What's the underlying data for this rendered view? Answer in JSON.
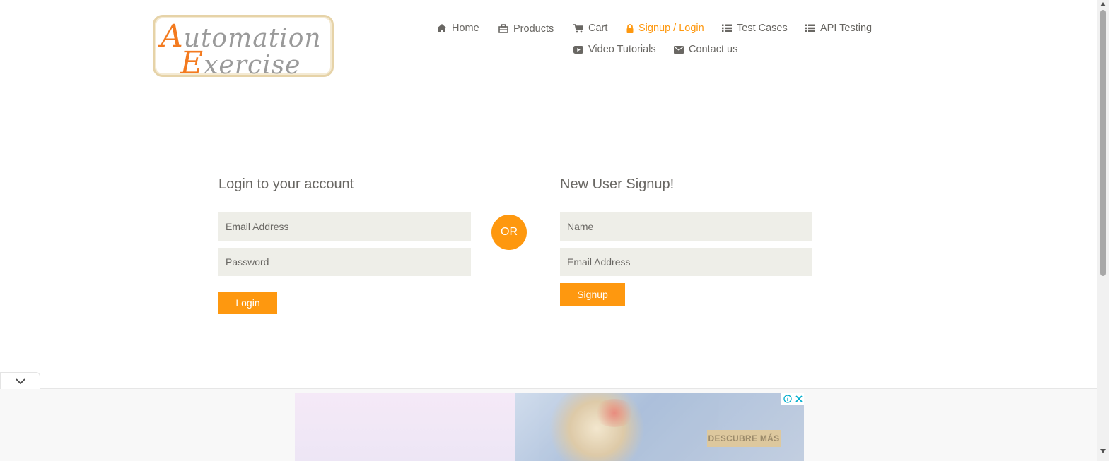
{
  "logo": {
    "line1_cap": "A",
    "line1_rest": "utomation",
    "line2_cap": "E",
    "line2_rest": "xercise"
  },
  "nav": {
    "home": "Home",
    "products": "Products",
    "cart": "Cart",
    "signup_login": "Signup / Login",
    "test_cases": "Test Cases",
    "api_testing": "API Testing",
    "video_tutorials": "Video Tutorials",
    "contact_us": "Contact us"
  },
  "login": {
    "title": "Login to your account",
    "email_placeholder": "Email Address",
    "password_placeholder": "Password",
    "button": "Login"
  },
  "or_label": "OR",
  "signup": {
    "title": "New User Signup!",
    "name_placeholder": "Name",
    "email_placeholder": "Email Address",
    "button": "Signup"
  },
  "ad": {
    "cta": "DESCUBRE MÁS"
  },
  "colors": {
    "accent": "#fe980f",
    "text": "#696763",
    "input_bg": "#eeeee8"
  }
}
